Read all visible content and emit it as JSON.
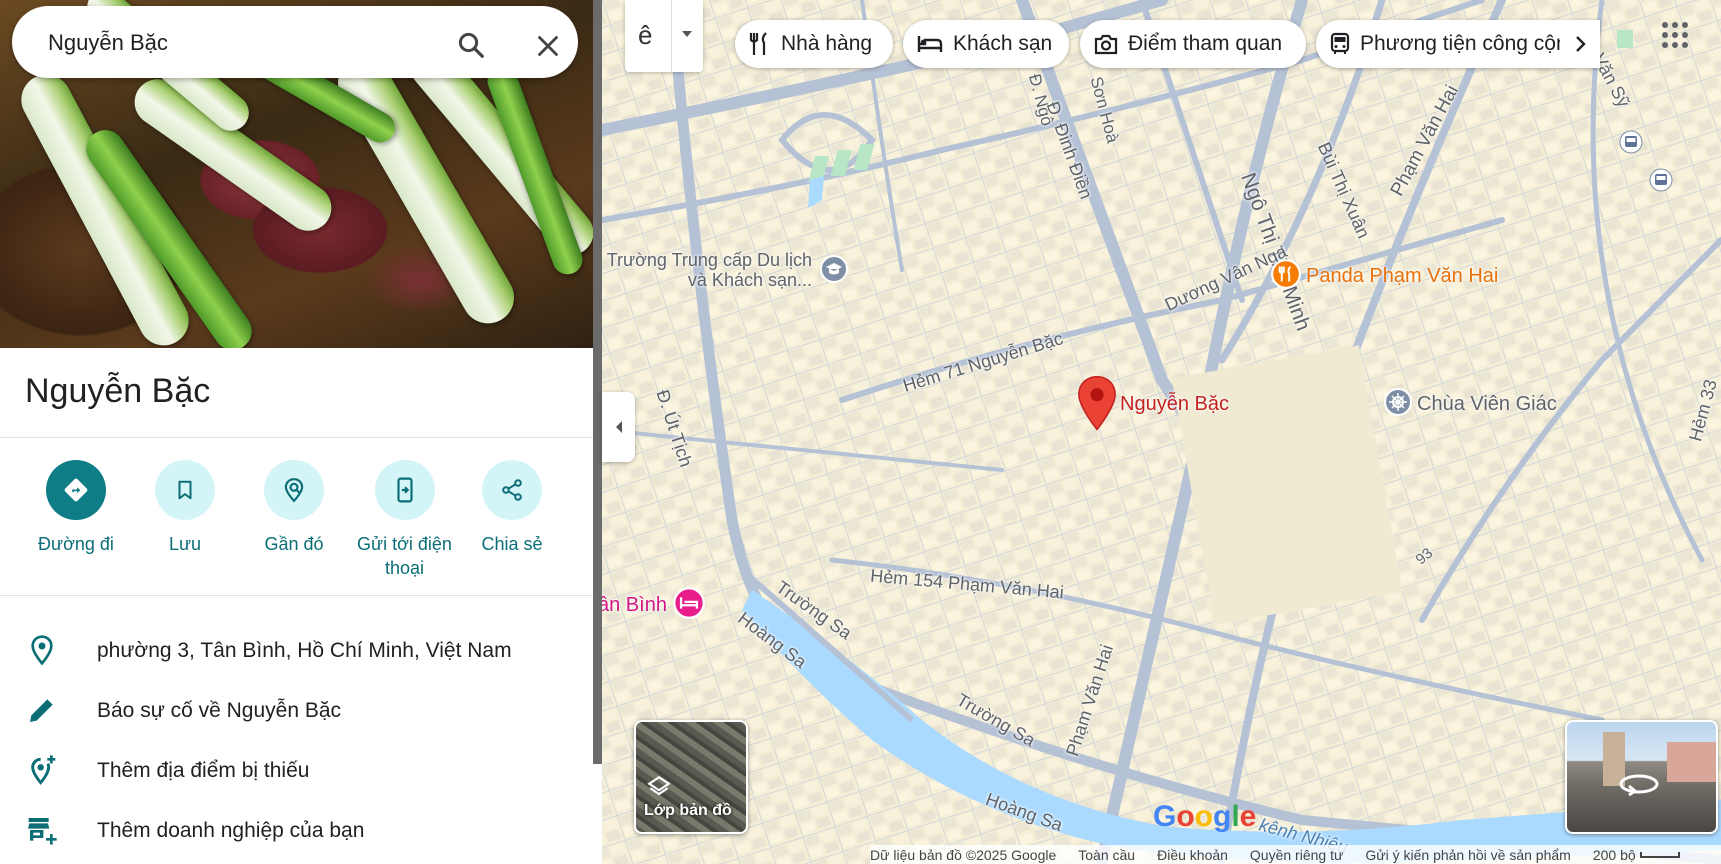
{
  "search": {
    "query": "Nguyễn Bặc"
  },
  "place": {
    "title": "Nguyễn Bặc"
  },
  "actions": [
    {
      "label": "Đường đi"
    },
    {
      "label": "Lưu"
    },
    {
      "label": "Gần đó"
    },
    {
      "label": "Gửi tới điện thoại"
    },
    {
      "label": "Chia sẻ"
    }
  ],
  "info": [
    {
      "icon": "location-pin-icon",
      "text": "phường 3, Tân Bình, Hồ Chí Minh, Việt Nam"
    },
    {
      "icon": "pencil-icon",
      "text": "Báo sự cố về Nguyễn Bặc"
    },
    {
      "icon": "add-location-icon",
      "text": "Thêm địa điểm bị thiếu"
    },
    {
      "icon": "add-business-icon",
      "text": "Thêm doanh nghiệp của bạn"
    }
  ],
  "ime": {
    "char": "ê"
  },
  "chips": [
    {
      "label": "Nhà hàng",
      "icon": "fork-knife-icon"
    },
    {
      "label": "Khách sạn",
      "icon": "bed-icon"
    },
    {
      "label": "Điểm tham quan",
      "icon": "camera-icon"
    },
    {
      "label": "Phương tiện công cộng",
      "icon": "bus-icon"
    }
  ],
  "map_labels": {
    "streets": [
      "Đ. Ngô",
      "Sơn Hoà",
      "Đ. Đinh Điền",
      "Ngô Thị Thu Minh",
      "Bùi Thị Xuân",
      "Phạm Văn Hai",
      "Văn Sỹ",
      "Dương Vân Nga",
      "Hẻm 71 Nguyễn Bặc",
      "Đ. Út Tịch",
      "Hẻm 154 Phạm Văn Hai",
      "Trường Sa",
      "Hoàng Sa",
      "Phạm Văn Hai",
      "Hẻm 33",
      "93",
      "kênh Nhiêu",
      "Trường Sa",
      "Hoàng Sa"
    ],
    "pois": {
      "school": "Trường Trung cấp Du lịch và Khách sạn...",
      "restaurant": "Panda Phạm Văn Hai",
      "selected": "Nguyễn Bặc",
      "temple": "Chùa Viên Giác",
      "hotel": "ân Bình"
    }
  },
  "layers": {
    "label": "Lớp bản đồ"
  },
  "footer": {
    "data": "Dữ liệu bản đồ ©2025 Google",
    "global": "Toàn cầu",
    "terms": "Điều khoản",
    "privacy": "Quyền riêng tư",
    "feedback": "Gửi ý kiến phản hồi về sản phẩm",
    "scale": "200 bộ"
  },
  "colors": {
    "accent": "#0e7d86",
    "accent_light": "#d4f5f8",
    "pin": "#ea4335",
    "canal": "#aadaff",
    "restaurant": "#f57c00",
    "hotel": "#e91e8c"
  }
}
